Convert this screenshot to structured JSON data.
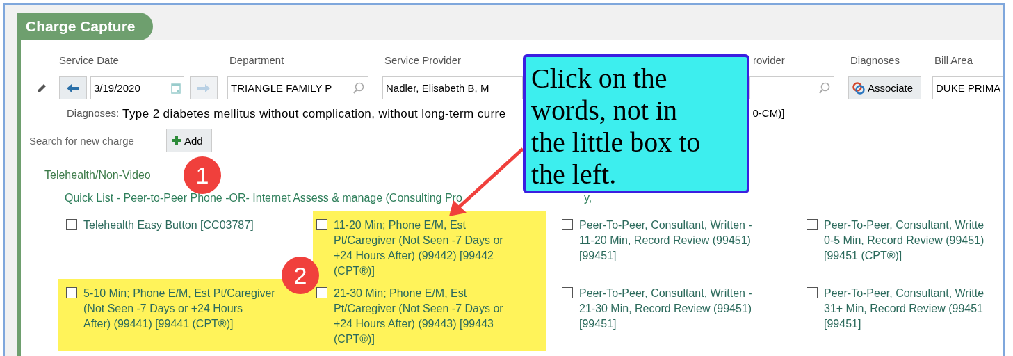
{
  "panel": {
    "title": "Charge Capture"
  },
  "header_labels": [
    "Service Date",
    "Department",
    "Service Provider",
    "rovider",
    "Diagnoses",
    "Bill Area"
  ],
  "service_date": {
    "value": "3/19/2020"
  },
  "department": {
    "value": "TRIANGLE FAMILY P"
  },
  "service_provider": {
    "value": "Nadler, Elisabeth B, M"
  },
  "associate_button": "Associate",
  "bill_area": {
    "value": "DUKE PRIMA"
  },
  "diagnoses": {
    "label": "Diagnoses:",
    "parts": [
      "Type 2 diabetes mellitus without complication, without long-term curre",
      "0-CM)]"
    ]
  },
  "search": {
    "placeholder": "Search for new charge",
    "button": "Add"
  },
  "section": "Telehealth/Non-Video",
  "quick_list": [
    "Quick List - Peer-to-Peer Phone -OR- Internet Assess & manage (Consulting Pro",
    "y,"
  ],
  "items": [
    {
      "label": "Telehealth Easy Button [CC03787]",
      "checked": false,
      "highlighted": false
    },
    {
      "label": "11-20 Min; Phone E/M, Est\nPt/Caregiver (Not Seen -7 Days or\n+24 Hours After) (99442) [99442\n(CPT®)]",
      "checked": false,
      "highlighted": true
    },
    {
      "label": "Peer-To-Peer, Consultant, Written -\n11-20 Min, Record Review (99451)\n[99451]",
      "checked": false,
      "highlighted": false
    },
    {
      "label": "Peer-To-Peer, Consultant, Writte\n0-5 Min, Record Review (99451)\n[99451 (CPT®)]",
      "checked": false,
      "highlighted": false
    },
    {
      "label": "5-10 Min; Phone E/M, Est Pt/Caregiver\n(Not Seen -7 Days or +24 Hours\nAfter) (99441) [99441 (CPT®)]",
      "checked": false,
      "highlighted": true
    },
    {
      "label": "21-30 Min; Phone E/M, Est\nPt/Caregiver (Not Seen -7 Days or\n+24 Hours After) (99443) [99443\n(CPT®)]",
      "checked": false,
      "highlighted": true
    },
    {
      "label": "Peer-To-Peer, Consultant, Written -\n21-30 Min, Record Review (99451)\n[99451]",
      "checked": false,
      "highlighted": false
    },
    {
      "label": "Peer-To-Peer, Consultant, Writte\n31+ Min, Record Review (99451\n[99451]",
      "checked": false,
      "highlighted": false
    }
  ],
  "callout": "Click on the\nwords, not in\nthe little box to\nthe left.",
  "badges": [
    "1",
    "2"
  ]
}
